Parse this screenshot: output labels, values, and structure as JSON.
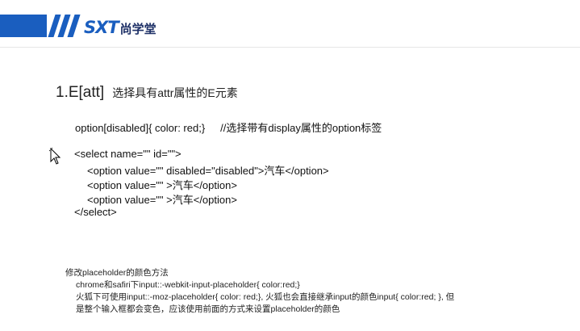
{
  "header": {
    "logo_mark": "SXT",
    "logo_text": "尚学堂",
    "brand_color": "#1a5ebf"
  },
  "slide": {
    "heading": {
      "selector": "1.E[att]",
      "description": "选择具有attr属性的E元素"
    },
    "css_line": {
      "code": "option[disabled]{ color: red;}",
      "comment": "//选择带有display属性的option标签"
    },
    "code_lines": [
      "<select name=\"\" id=\"\">",
      "<option value=\"\" disabled=\"disabled\">汽车</option>",
      "<option value=\"\" >汽车</option>",
      "<option value=\"\" >汽车</option>",
      "</select>"
    ],
    "notes": {
      "title": "修改placeholder的颜色方法",
      "line1": "chrome和safiri下input::-webkit-input-placeholder{ color:red;}",
      "line2": "火狐下可使用input::-moz-placeholder{ color: red;}, 火狐也会直接继承input的颜色input{ color:red; }, 但",
      "line3": "是整个输入框都会变色，应该使用前面的方式来设置placeholder的颜色"
    }
  }
}
